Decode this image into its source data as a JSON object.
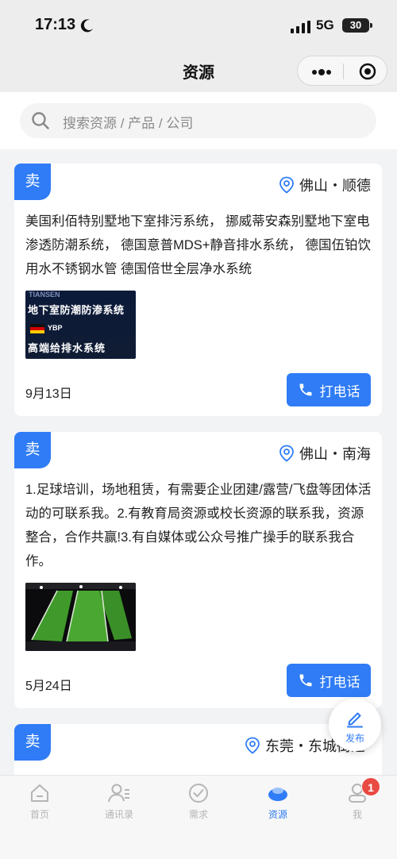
{
  "status_bar": {
    "time": "17:13",
    "network": "5G",
    "battery": "30"
  },
  "nav": {
    "title": "资源"
  },
  "search": {
    "placeholder": "搜索资源 / 产品 / 公司"
  },
  "listings": [
    {
      "tag": "卖",
      "location": "佛山・顺德",
      "description": "美国利佰特别墅地下室排污系统， 挪威蒂安森别墅地下室电渗透防潮系统， 德国意普MDS+静音排水系统， 德国伍铂饮用水不锈钢水管 德国倍世全层净水系统",
      "thumb": {
        "brand": "TIANSEN",
        "line1": "地下室防潮防渗系统",
        "badge": "YBP",
        "line2": "高端给排水系统"
      },
      "date": "9月13日",
      "call_label": "打电话"
    },
    {
      "tag": "卖",
      "location": "佛山・南海",
      "description": "1.足球培训，场地租赁，有需要企业团建/露营/飞盘等团体活动的可联系我。2.有教育局资源或校长资源的联系我，资源整合，合作共赢!3.有自媒体或公众号推广操手的联系我合作。",
      "date": "5月24日",
      "call_label": "打电话"
    },
    {
      "tag": "卖",
      "location": "东莞・东城街道"
    }
  ],
  "fab": {
    "label": "发布"
  },
  "tabbar": {
    "items": [
      {
        "label": "首页",
        "icon": "home-icon"
      },
      {
        "label": "通讯录",
        "icon": "contacts-icon"
      },
      {
        "label": "需求",
        "icon": "check-circle-icon"
      },
      {
        "label": "资源",
        "icon": "resource-icon",
        "active": true
      },
      {
        "label": "我",
        "icon": "profile-icon",
        "badge": "1"
      }
    ]
  },
  "colors": {
    "accent": "#2f7cf6",
    "badge": "#e94a43"
  }
}
